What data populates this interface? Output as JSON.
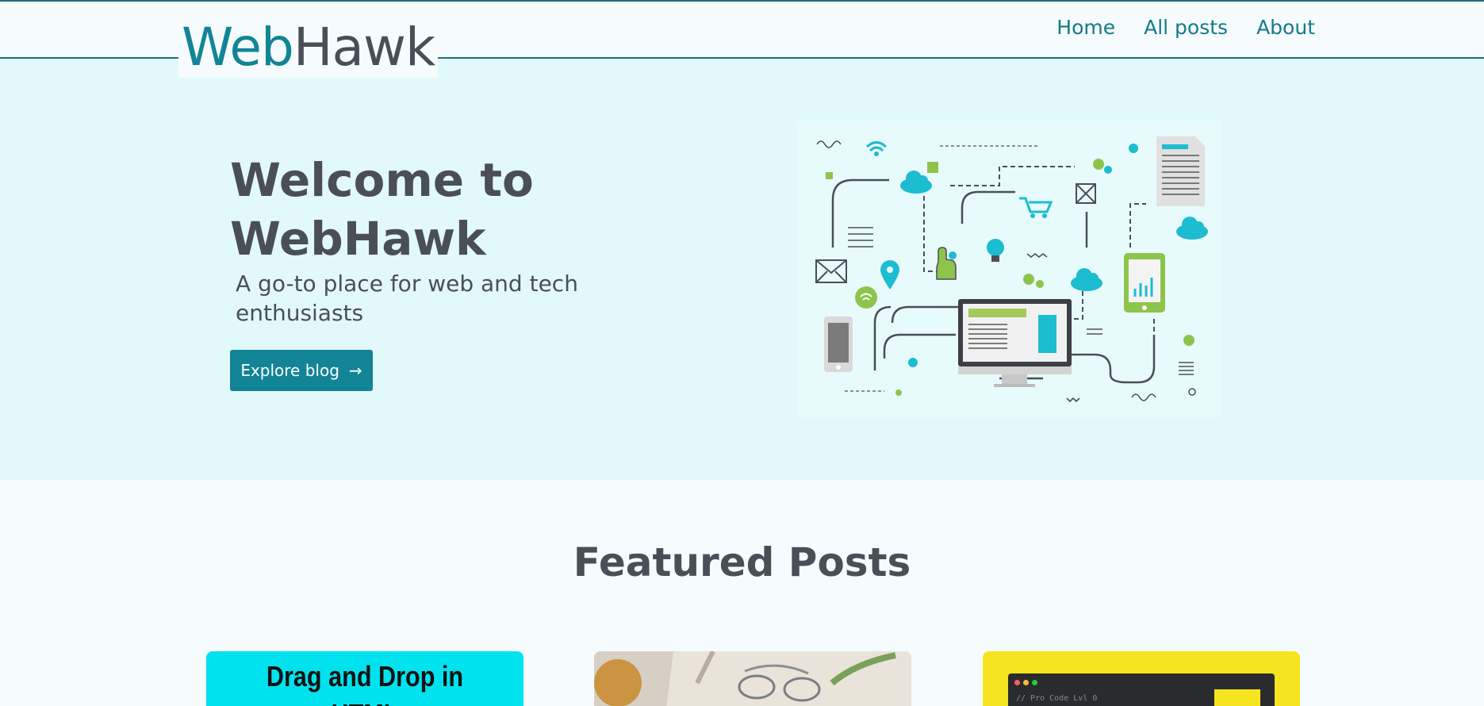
{
  "brand": {
    "part1": "Web",
    "part2": "Hawk"
  },
  "nav": [
    "Home",
    "All posts",
    "About"
  ],
  "hero": {
    "title": "Welcome to WebHawk",
    "subtitle": "A go-to place for web and tech enthusiasts",
    "button_label": "Explore blog",
    "button_icon": "→"
  },
  "featured": {
    "title": "Featured Posts",
    "cards": [
      {
        "title": "Drag and Drop in HTML"
      },
      {
        "image": "desk-photo"
      },
      {
        "image": "code-editor",
        "code_comment": "// Pro Code Lvl 0"
      }
    ]
  },
  "colors": {
    "accent": "#138496",
    "text": "#4a4f57",
    "hero_bg": "#e2f9fb",
    "green": "#8dc44b",
    "cyan": "#1cbcd1"
  }
}
